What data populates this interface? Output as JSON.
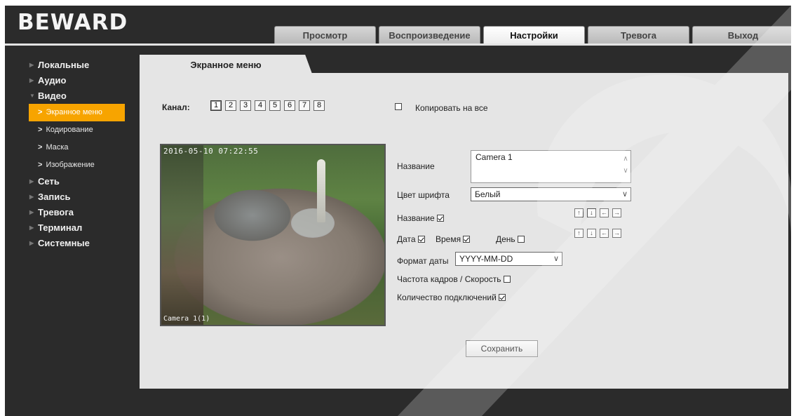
{
  "brand": {
    "logo": "BEWARD"
  },
  "tabs": [
    {
      "label": "Просмотр"
    },
    {
      "label": "Воспроизведение"
    },
    {
      "label": "Настройки",
      "active": true
    },
    {
      "label": "Тревога"
    },
    {
      "label": "Выход"
    }
  ],
  "sidebar": {
    "items": [
      {
        "label": "Локальные"
      },
      {
        "label": "Аудио"
      },
      {
        "label": "Видео",
        "expanded": true
      },
      {
        "label": "Сеть"
      },
      {
        "label": "Запись"
      },
      {
        "label": "Тревога"
      },
      {
        "label": "Терминал"
      },
      {
        "label": "Системные"
      }
    ],
    "video_sub": [
      {
        "label": "Экранное меню",
        "active": true
      },
      {
        "label": "Кодирование"
      },
      {
        "label": "Маска"
      },
      {
        "label": "Изображение"
      }
    ]
  },
  "page": {
    "tab_title": "Экранное меню",
    "channel_label": "Канал:",
    "channels": [
      "1",
      "2",
      "3",
      "4",
      "5",
      "6",
      "7",
      "8"
    ],
    "selected_channel": "1",
    "copy_all_label": "Копировать на все",
    "copy_all_checked": false
  },
  "preview": {
    "timestamp": "2016-05-10 07:22:55",
    "osd_name": "Camera 1(1)"
  },
  "form": {
    "name_label": "Название",
    "name_value": "Camera 1",
    "font_color_label": "Цвет шрифта",
    "font_color_value": "Белый",
    "show_name_label": "Название",
    "show_name_checked": true,
    "date_label": "Дата",
    "date_checked": true,
    "time_label": "Время",
    "time_checked": true,
    "day_label": "День",
    "day_checked": false,
    "date_format_label": "Формат даты",
    "date_format_value": "YYYY-MM-DD",
    "fps_label": "Частота кадров / Скорость",
    "fps_checked": false,
    "connections_label": "Количество подключений",
    "connections_checked": true,
    "save_label": "Сохранить",
    "arrows": {
      "up": "↑",
      "down": "↓",
      "left": "←",
      "right": "→"
    }
  },
  "colors": {
    "background": "#2b2b2b",
    "panel": "#e5e5e5",
    "accent": "#f7a400"
  }
}
